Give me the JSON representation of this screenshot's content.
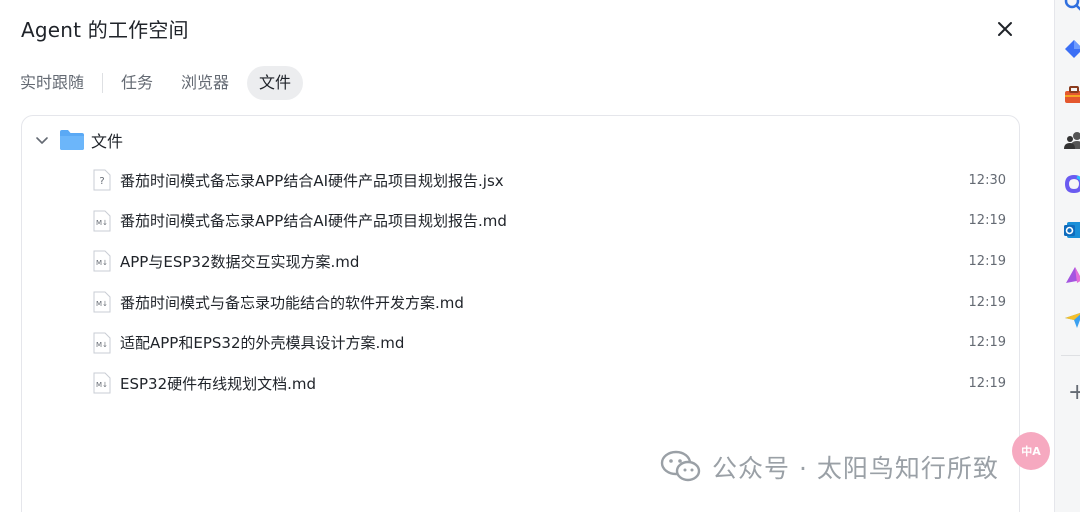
{
  "header": {
    "title": "Agent 的工作空间"
  },
  "tabs": [
    {
      "label": "实时跟随",
      "active": false
    },
    {
      "label": "任务",
      "active": false
    },
    {
      "label": "浏览器",
      "active": false
    },
    {
      "label": "文件",
      "active": true
    }
  ],
  "folder": {
    "label": "文件",
    "expanded": true,
    "color": "#5aa9f5"
  },
  "files": [
    {
      "name": "番茄时间模式备忘录APP结合AI硬件产品项目规划报告.jsx",
      "time": "12:30",
      "icon": "unknown-file-icon",
      "icon_glyph": "?"
    },
    {
      "name": "番茄时间模式备忘录APP结合AI硬件产品项目规划报告.md",
      "time": "12:19",
      "icon": "markdown-file-icon",
      "icon_glyph": "M↓"
    },
    {
      "name": "APP与ESP32数据交互实现方案.md",
      "time": "12:19",
      "icon": "markdown-file-icon",
      "icon_glyph": "M↓"
    },
    {
      "name": "番茄时间模式与备忘录功能结合的软件开发方案.md",
      "time": "12:19",
      "icon": "markdown-file-icon",
      "icon_glyph": "M↓"
    },
    {
      "name": "适配APP和EPS32的外壳模具设计方案.md",
      "time": "12:19",
      "icon": "markdown-file-icon",
      "icon_glyph": "M↓"
    },
    {
      "name": "ESP32硬件布线规划文档.md",
      "time": "12:19",
      "icon": "markdown-file-icon",
      "icon_glyph": "M↓"
    }
  ],
  "right_rail": {
    "icons": [
      "search-icon",
      "blue-diamond-app-icon",
      "toolbox-app-icon",
      "people-app-icon",
      "copilot-app-icon",
      "outlook-app-icon",
      "purple-app-icon",
      "send-app-icon",
      "add-icon"
    ],
    "plus_label": "+"
  },
  "translate_bubble": {
    "label": "中A"
  },
  "watermark": {
    "text": "公众号 · 太阳鸟知行所致"
  },
  "colors": {
    "accent_blue": "#5aa9f5",
    "text_primary": "#1f2329",
    "text_secondary": "#646a73",
    "active_tab_bg": "#ecedef",
    "border": "#e5e6eb"
  }
}
